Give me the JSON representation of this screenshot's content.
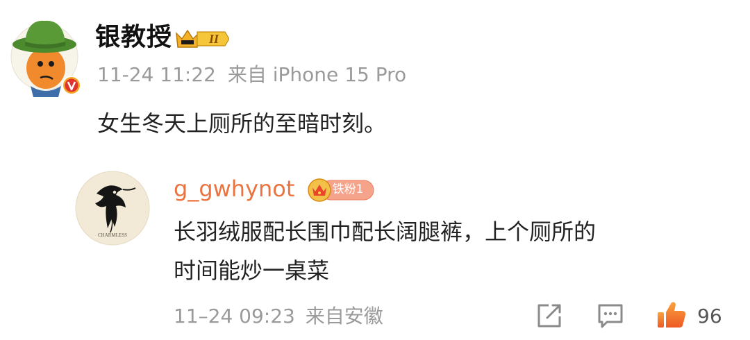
{
  "post": {
    "author": "银教授",
    "author_badge_label": "II",
    "timestamp": "11-24 11:22",
    "source": "来自 iPhone 15 Pro",
    "text": "女生冬天上厕所的至暗时刻。"
  },
  "comment": {
    "username": "g_gwhynot",
    "fan_badge": "铁粉1",
    "text_line1": "长羽绒服配长围巾配长阔腿裤，上个厕所的",
    "text_line2": "时间能炒一桌菜",
    "timestamp": "11–24 09:23",
    "source": "来自安徽",
    "likes": "96",
    "avatar_caption": "CHARMLESS"
  },
  "colors": {
    "username": "#eb7340",
    "meta": "#9a9a9a",
    "like": "#f06e2c",
    "verified": "#f5a623"
  },
  "icons": {
    "share": "share-icon",
    "comment": "comment-icon",
    "like": "thumbs-up-icon",
    "verified": "verified-v-icon",
    "crown": "crown-icon"
  }
}
